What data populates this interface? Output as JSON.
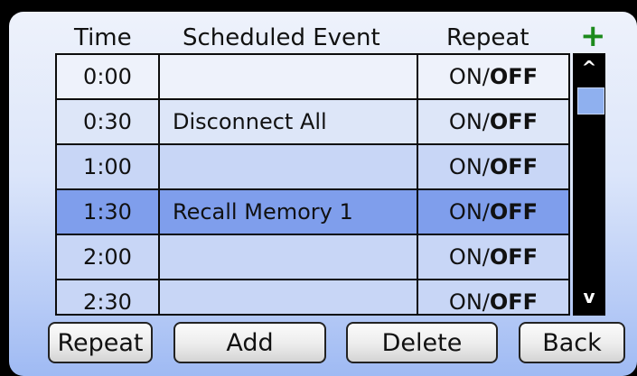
{
  "header": {
    "time": "Time",
    "event": "Scheduled Event",
    "repeat": "Repeat",
    "add_icon": "plus-icon"
  },
  "rows": [
    {
      "time": "0:00",
      "event": "",
      "repeat_on": "ON/",
      "repeat_off": "OFF"
    },
    {
      "time": "0:30",
      "event": "Disconnect All",
      "repeat_on": "ON/",
      "repeat_off": "OFF"
    },
    {
      "time": "1:00",
      "event": "",
      "repeat_on": "ON/",
      "repeat_off": "OFF"
    },
    {
      "time": "1:30",
      "event": "Recall Memory 1",
      "repeat_on": "ON/",
      "repeat_off": "OFF",
      "selected": true
    },
    {
      "time": "2:00",
      "event": "",
      "repeat_on": "ON/",
      "repeat_off": "OFF"
    },
    {
      "time": "2:30",
      "event": "",
      "repeat_on": "ON/",
      "repeat_off": "OFF"
    }
  ],
  "scrollbar": {
    "up": "^",
    "down": "v"
  },
  "buttons": {
    "repeat": "Repeat",
    "add": "Add",
    "delete": "Delete",
    "back": "Back"
  },
  "colors": {
    "selected_row": "#7f9eec",
    "plus": "#1c8a1c",
    "scroll_thumb": "#8fb0ef"
  }
}
